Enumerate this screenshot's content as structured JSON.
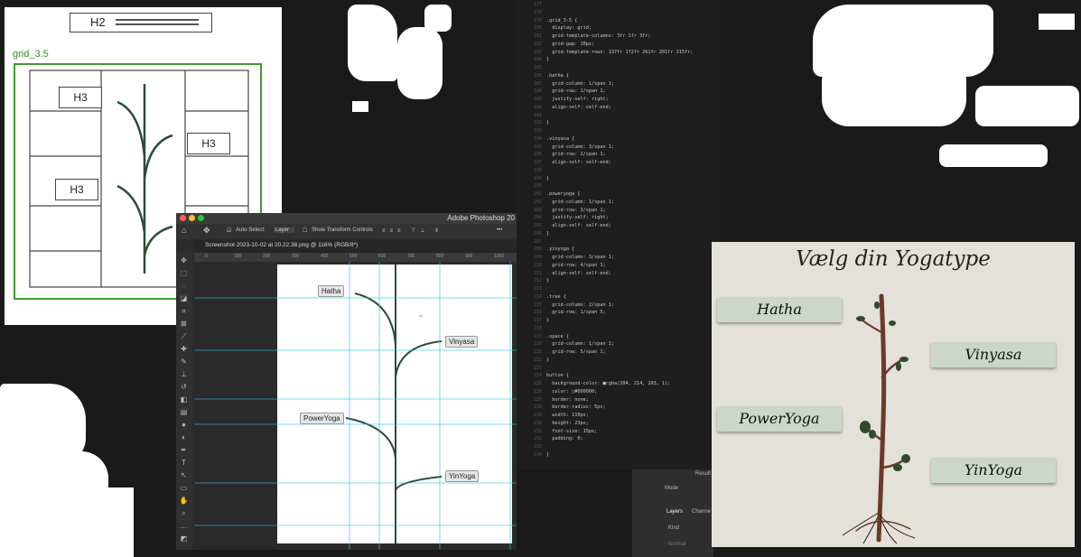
{
  "sketch": {
    "h2": "H2",
    "grid_label": "grid_3.5",
    "h3_boxes": [
      "H3",
      "H3",
      "H3"
    ]
  },
  "code_editor": {
    "lines": [
      {
        "n": "177",
        "t": ""
      },
      {
        "n": "178",
        "t": ""
      },
      {
        "n": "179",
        "t": ".grid_3-5 {"
      },
      {
        "n": "180",
        "t": "  display: grid;"
      },
      {
        "n": "181",
        "t": "  grid-template-columns: 3fr 1fr 3fr;"
      },
      {
        "n": "182",
        "t": "  grid-gap: 10px;"
      },
      {
        "n": "183",
        "t": "  grid-template-rows: 137fr 172fr 261fr 201fr 215fr;"
      },
      {
        "n": "184",
        "t": "}"
      },
      {
        "n": "185",
        "t": ""
      },
      {
        "n": "186",
        "t": ".hatha {"
      },
      {
        "n": "187",
        "t": "  grid-column: 1/span 1;"
      },
      {
        "n": "188",
        "t": "  grid-row: 1/span 1;"
      },
      {
        "n": "189",
        "t": "  justify-self: right;"
      },
      {
        "n": "190",
        "t": "  align-self: self-end;"
      },
      {
        "n": "191",
        "t": ""
      },
      {
        "n": "192",
        "t": "}"
      },
      {
        "n": "193",
        "t": ""
      },
      {
        "n": "194",
        "t": ".vinyasa {"
      },
      {
        "n": "195",
        "t": "  grid-column: 3/span 1;"
      },
      {
        "n": "196",
        "t": "  grid-row: 2/span 1;"
      },
      {
        "n": "197",
        "t": "  align-self: self-end;"
      },
      {
        "n": "198",
        "t": ""
      },
      {
        "n": "199",
        "t": "}"
      },
      {
        "n": "200",
        "t": ""
      },
      {
        "n": "201",
        "t": ".poweryoga {"
      },
      {
        "n": "202",
        "t": "  grid-column: 1/span 1;"
      },
      {
        "n": "203",
        "t": "  grid-row: 3/span 1;"
      },
      {
        "n": "204",
        "t": "  justify-self: right;"
      },
      {
        "n": "205",
        "t": "  align-self: self-end;"
      },
      {
        "n": "206",
        "t": "}"
      },
      {
        "n": "207",
        "t": ""
      },
      {
        "n": "208",
        "t": ".yinyoga {"
      },
      {
        "n": "209",
        "t": "  grid-column: 3/span 1;"
      },
      {
        "n": "210",
        "t": "  grid-row: 4/span 1;"
      },
      {
        "n": "211",
        "t": "  align-self: self-end;"
      },
      {
        "n": "212",
        "t": "}"
      },
      {
        "n": "213",
        "t": ""
      },
      {
        "n": "214",
        "t": ".tree {"
      },
      {
        "n": "215",
        "t": "  grid-column: 2/span 1;"
      },
      {
        "n": "216",
        "t": "  grid-row: 1/span 5;"
      },
      {
        "n": "217",
        "t": "}"
      },
      {
        "n": "218",
        "t": ""
      },
      {
        "n": "219",
        "t": ".space {"
      },
      {
        "n": "220",
        "t": "  grid-column: 1/span 1;"
      },
      {
        "n": "221",
        "t": "  grid-row: 5/span 1;"
      },
      {
        "n": "222",
        "t": "}"
      },
      {
        "n": "223",
        "t": ""
      },
      {
        "n": "224",
        "t": "button {"
      },
      {
        "n": "225",
        "t": "  background-color: ■rgba(204, 214, 203, 1);"
      },
      {
        "n": "226",
        "t": "  color: □#000000;"
      },
      {
        "n": "227",
        "t": "  border: none;"
      },
      {
        "n": "228",
        "t": "  border-radius: 5px;"
      },
      {
        "n": "229",
        "t": "  width: 110px;"
      },
      {
        "n": "230",
        "t": "  height: 23px;"
      },
      {
        "n": "231",
        "t": "  font-size: 15px;"
      },
      {
        "n": "232",
        "t": "  padding: 0;"
      },
      {
        "n": "233",
        "t": ""
      },
      {
        "n": "234",
        "t": "}"
      }
    ]
  },
  "photoshop": {
    "app_title": "Adobe Photoshop 20",
    "auto_select": "Auto-Select:",
    "layer_select": "Layer",
    "transform_controls": "Show Transform Controls",
    "doc_tab": "Screenshot 2023-10-02 at 20.22.38.png @ 116% (RGB/8*)",
    "ruler_marks": [
      "0",
      "100",
      "200",
      "300",
      "400",
      "500",
      "600",
      "700",
      "800",
      "900",
      "1000"
    ],
    "labels": {
      "hatha": "Hatha",
      "vinyasa": "Vinyasa",
      "poweryoga": "PowerYoga",
      "yinyoga": "YinYoga"
    },
    "panel": {
      "mode": "Mode",
      "layers_tab": "Layers",
      "channels_tab": "Channe",
      "kind": "Kind",
      "normal": "Normal",
      "result": "Result"
    }
  },
  "site": {
    "heading": "Vælg din Yogatype",
    "buttons": {
      "hatha": "Hatha",
      "vinyasa": "Vinyasa",
      "poweryoga": "PowerYoga",
      "yinyoga": "YinYoga"
    },
    "button_color": "#ccd6cb"
  }
}
